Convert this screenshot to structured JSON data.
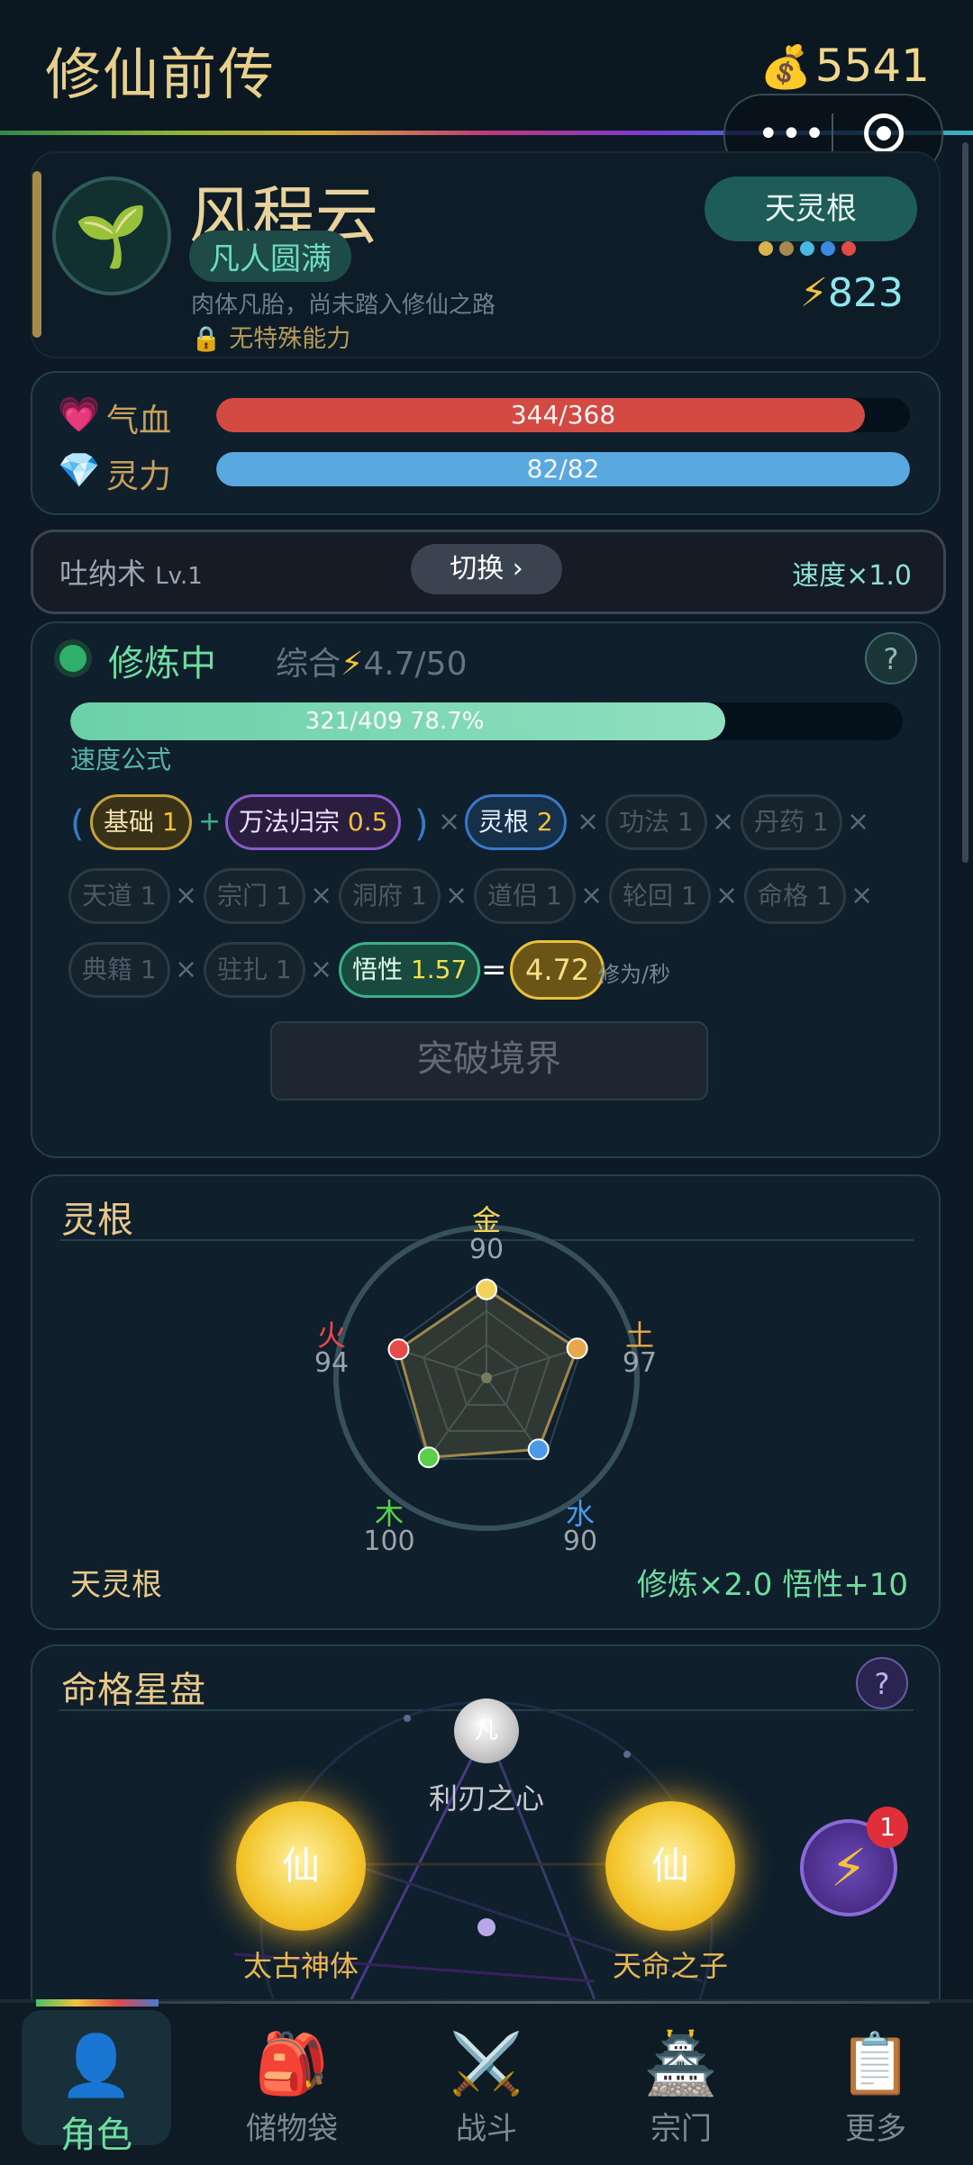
{
  "header": {
    "title": "修仙前传",
    "coins": "5541",
    "coin_icon": "money-bag-icon"
  },
  "profile": {
    "avatar_icon": "sprout-icon",
    "name": "风程云",
    "realm": "凡人圆满",
    "desc": "肉体凡胎，尚未踏入修仙之路",
    "ability": "无特殊能力",
    "root_button": "天灵根",
    "root_colors": [
      "#d8b54a",
      "#a88850",
      "#4ab8e0",
      "#3a8ae0",
      "#e04a4a"
    ],
    "power": "823"
  },
  "stats": {
    "hp": {
      "label": "气血",
      "text": "344/368",
      "fraction": 0.935,
      "color": "#d24a42"
    },
    "mp": {
      "label": "灵力",
      "text": "82/82",
      "fraction": 1.0,
      "color": "#5aa8e0"
    }
  },
  "technique": {
    "name": "吐纳术",
    "level": "Lv.1",
    "switch_label": "切换 ›",
    "speed": "速度×1.0"
  },
  "cultivation": {
    "status": "修炼中",
    "combined_label": "综合",
    "combined_value": "4.7/50",
    "help": "?",
    "progress_text": "321/409  78.7%",
    "progress_fraction": 0.787,
    "formula_label": "速度公式",
    "paren_open": "(",
    "paren_close": ")",
    "plus": "+",
    "times": "×",
    "equals": "=",
    "chips": [
      {
        "name": "基础",
        "value": "1"
      },
      {
        "name": "万法归宗",
        "value": "0.5"
      },
      {
        "name": "灵根",
        "value": "2"
      },
      {
        "name": "功法",
        "value": "1"
      },
      {
        "name": "丹药",
        "value": "1"
      },
      {
        "name": "天道",
        "value": "1"
      },
      {
        "name": "宗门",
        "value": "1"
      },
      {
        "name": "洞府",
        "value": "1"
      },
      {
        "name": "道侣",
        "value": "1"
      },
      {
        "name": "轮回",
        "value": "1"
      },
      {
        "name": "命格",
        "value": "1"
      },
      {
        "name": "典籍",
        "value": "1"
      },
      {
        "name": "驻扎",
        "value": "1"
      },
      {
        "name": "悟性",
        "value": "1.57"
      }
    ],
    "result": "4.72",
    "result_unit": "修为/秒",
    "breakthrough": "突破境界"
  },
  "spirit_root": {
    "title": "灵根",
    "elements": [
      {
        "name": "金",
        "value": "90",
        "color": "#f2d35a"
      },
      {
        "name": "土",
        "value": "97",
        "color": "#e8a84a"
      },
      {
        "name": "水",
        "value": "90",
        "color": "#4a9ae8"
      },
      {
        "name": "木",
        "value": "100",
        "color": "#5ad04a"
      },
      {
        "name": "火",
        "value": "94",
        "color": "#e84a4a"
      }
    ],
    "type": "天灵根",
    "bonus": "修炼×2.0  悟性+10"
  },
  "star_chart": {
    "title": "命格星盘",
    "help": "?",
    "top": {
      "glyph": "凡",
      "label": "利刃之心"
    },
    "left": {
      "glyph": "仙",
      "label": "太古神体"
    },
    "right": {
      "glyph": "仙",
      "label": "天命之子"
    },
    "badge": "1"
  },
  "nav": [
    {
      "label": "角色",
      "icon": "character-icon"
    },
    {
      "label": "储物袋",
      "icon": "backpack-icon"
    },
    {
      "label": "战斗",
      "icon": "crossed-swords-icon"
    },
    {
      "label": "宗门",
      "icon": "pagoda-icon"
    },
    {
      "label": "更多",
      "icon": "clipboard-icon"
    }
  ]
}
